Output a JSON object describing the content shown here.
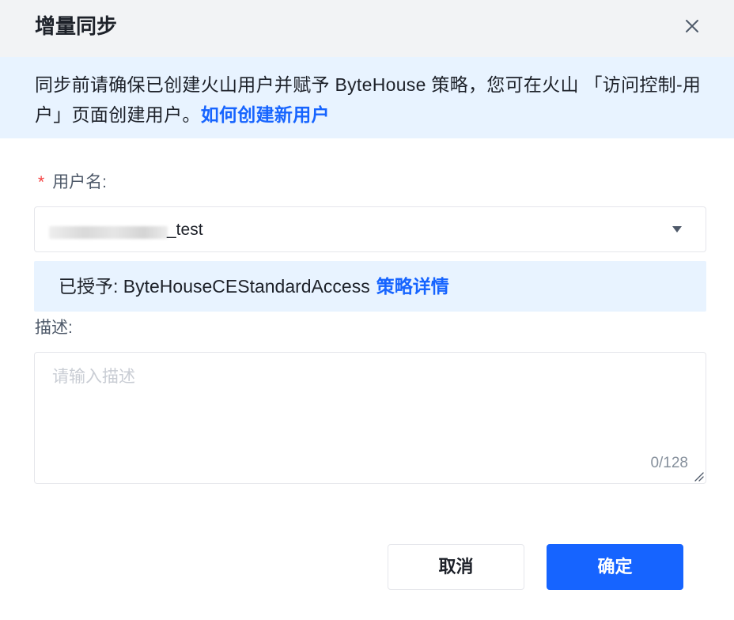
{
  "dialog": {
    "title": "增量同步"
  },
  "notice": {
    "text": "同步前请确保已创建火山用户并赋予 ByteHouse 策略，您可在火山 「访问控制-用户」页面创建用户。",
    "link": "如何创建新用户"
  },
  "form": {
    "username": {
      "required_mark": "*",
      "label": "用户名:",
      "value_suffix": "_test",
      "icon": "chevron-down-icon"
    },
    "granted": {
      "text": "已授予: ByteHouseCEStandardAccess",
      "link": "策略详情"
    },
    "description": {
      "label": "描述:",
      "placeholder": "请输入描述",
      "counter": "0/128"
    }
  },
  "footer": {
    "cancel_label": "取消",
    "ok_label": "确定"
  },
  "colors": {
    "primary": "#1664ff",
    "header_bg": "#f2f3f5",
    "info_bg": "#e8f3ff",
    "required": "#f53f3f"
  }
}
